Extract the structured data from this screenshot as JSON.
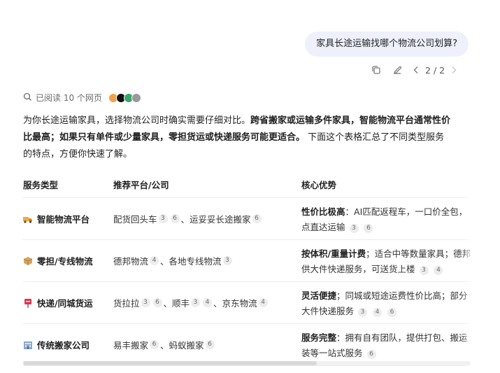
{
  "user_message": "家具长途运输找哪个物流公司划算?",
  "pager": {
    "current": "2",
    "sep": "/",
    "total": "2"
  },
  "search": {
    "label": "已阅读 10 个网页"
  },
  "intro": {
    "p1": "为你长途运输家具，选择物流公司时确实需要仔细对比。",
    "b1": "跨省搬家或运输多件家具，智能物流平台通常性价",
    "b2": "比最高；如果只有单件或少量家具，零担货运或快递服务可能更适合。",
    "p2": " 下面这个表格汇总了不同类型服务",
    "p3": "的特点，方便你快速了解。"
  },
  "table": {
    "headers": [
      "服务类型",
      "推荐平台/公司",
      "核心优势"
    ],
    "rows": [
      {
        "type": "智能物流平台",
        "p1": "配货回头车",
        "p1b": [
          "3",
          "6"
        ],
        "p2": "运妥妥长途搬家",
        "p2b": [
          "6"
        ],
        "adv_strong": "性价比极高",
        "adv_l1": "：AI匹配返程车，一口价全包，",
        "adv_l2": "点直达运输",
        "adv_b": [
          "3",
          "6"
        ]
      },
      {
        "type": "零担/专线物流",
        "p1": "德邦物流",
        "p1b": [
          "4"
        ],
        "p2": "各地专线物流",
        "p2b": [
          "3"
        ],
        "adv_strong": "按体积/重量计费",
        "adv_l1": "；适合中等数量家具；德邦",
        "adv_l2": "供大件快递服务，可送货上楼",
        "adv_b": [
          "3",
          "4"
        ]
      },
      {
        "type": "快递/同城货运",
        "p1": "货拉拉",
        "p1b": [
          "3",
          "6"
        ],
        "p2": "顺丰",
        "p2b": [
          "3",
          "4"
        ],
        "p3": "京东物流",
        "p3b": [
          "4"
        ],
        "adv_strong": "灵活便捷",
        "adv_l1": "；同城或短途运费性价比高；部分",
        "adv_l2": "大件快递服务",
        "adv_b": [
          "3",
          "4",
          "6"
        ]
      },
      {
        "type": "传统搬家公司",
        "p1": "易丰搬家",
        "p1b": [
          "6"
        ],
        "p2": "蚂蚁搬家",
        "p2b": [
          "6"
        ],
        "adv_strong": "服务完整",
        "adv_l1": "：拥有自有团队，提供打包、搬运",
        "adv_l2": "装等一站式服务",
        "adv_b": [
          "6"
        ]
      }
    ],
    "sep": "、"
  },
  "colors": {
    "bubble_bg": "#eef1fb",
    "badge_bg": "#ececec"
  }
}
